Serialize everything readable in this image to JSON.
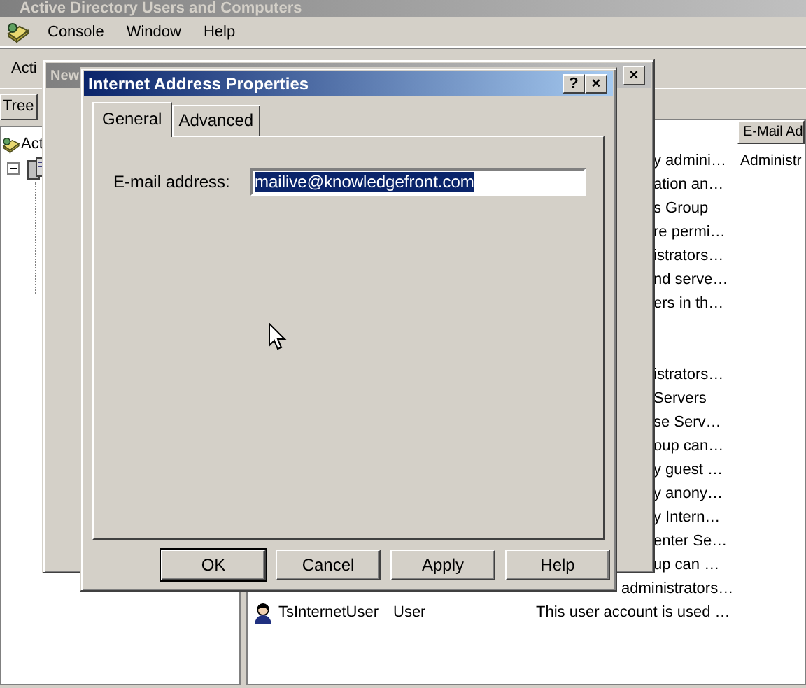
{
  "main_window": {
    "title": "Active Directory Users and Computers",
    "menu": [
      "Console",
      "Window",
      "Help"
    ],
    "toolbar": {
      "action_menu": "Acti"
    },
    "tree": {
      "tab": "Tree",
      "root": "Act"
    },
    "list": {
      "columns": [
        {
          "label": "E-Mail Ad"
        }
      ],
      "rows": [
        {
          "kind": "covered",
          "description": "y admini…",
          "email": "Administr"
        },
        {
          "kind": "covered",
          "description": "ation an…"
        },
        {
          "kind": "covered",
          "description": "s Group"
        },
        {
          "kind": "covered",
          "description": "re permi…"
        },
        {
          "kind": "covered",
          "description": "istrators…"
        },
        {
          "kind": "covered",
          "description": "nd serve…"
        },
        {
          "kind": "covered",
          "description": "ers in th…"
        },
        {
          "kind": "covered",
          "description": "istrators…"
        },
        {
          "kind": "covered",
          "description": "Servers"
        },
        {
          "kind": "covered",
          "description": "se Serv…"
        },
        {
          "kind": "covered",
          "description": "oup can…"
        },
        {
          "kind": "covered",
          "description": "y guest …"
        },
        {
          "kind": "covered",
          "description": "y anony…"
        },
        {
          "kind": "covered",
          "description": "y Intern…"
        },
        {
          "kind": "covered",
          "description": "enter Se…"
        },
        {
          "kind": "covered",
          "description": "up can …"
        },
        {
          "kind": "below_dialog",
          "description": "administrators…"
        },
        {
          "kind": "full",
          "name": "TsInternetUser",
          "type": "User",
          "description": "This user account is used …"
        }
      ]
    }
  },
  "middle_window": {
    "title": "New",
    "caption_buttons": [
      "×"
    ]
  },
  "dialog": {
    "title": "Internet Address Properties",
    "caption_buttons": [
      "?",
      "×"
    ],
    "tabs": [
      {
        "label": "General",
        "selected": true
      },
      {
        "label": "Advanced",
        "selected": false
      }
    ],
    "email_field": {
      "label": "E-mail address:",
      "value": "mailive@knowledgefront.com",
      "text_selected": true
    },
    "buttons": [
      "OK",
      "Cancel",
      "Apply",
      "Help"
    ]
  }
}
